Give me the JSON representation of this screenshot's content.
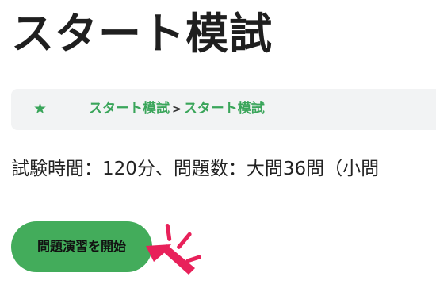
{
  "page": {
    "title": "スタート模試"
  },
  "breadcrumb": {
    "star_icon": "★",
    "items": [
      {
        "label": "スタート模試"
      },
      {
        "label": "スタート模試"
      }
    ],
    "separator": ">"
  },
  "exam": {
    "info_text": "試験時間：120分、問題数：大問36問（小問"
  },
  "actions": {
    "start_label": "問題演習を開始"
  },
  "colors": {
    "accent_green": "#43ac5b",
    "link_green": "#3aa55a",
    "pointer_red": "#e8215a",
    "breadcrumb_bg": "#f2f3f4"
  },
  "icons": {
    "breadcrumb": "star-icon",
    "pointer": "red-arrow-pointer-icon"
  }
}
